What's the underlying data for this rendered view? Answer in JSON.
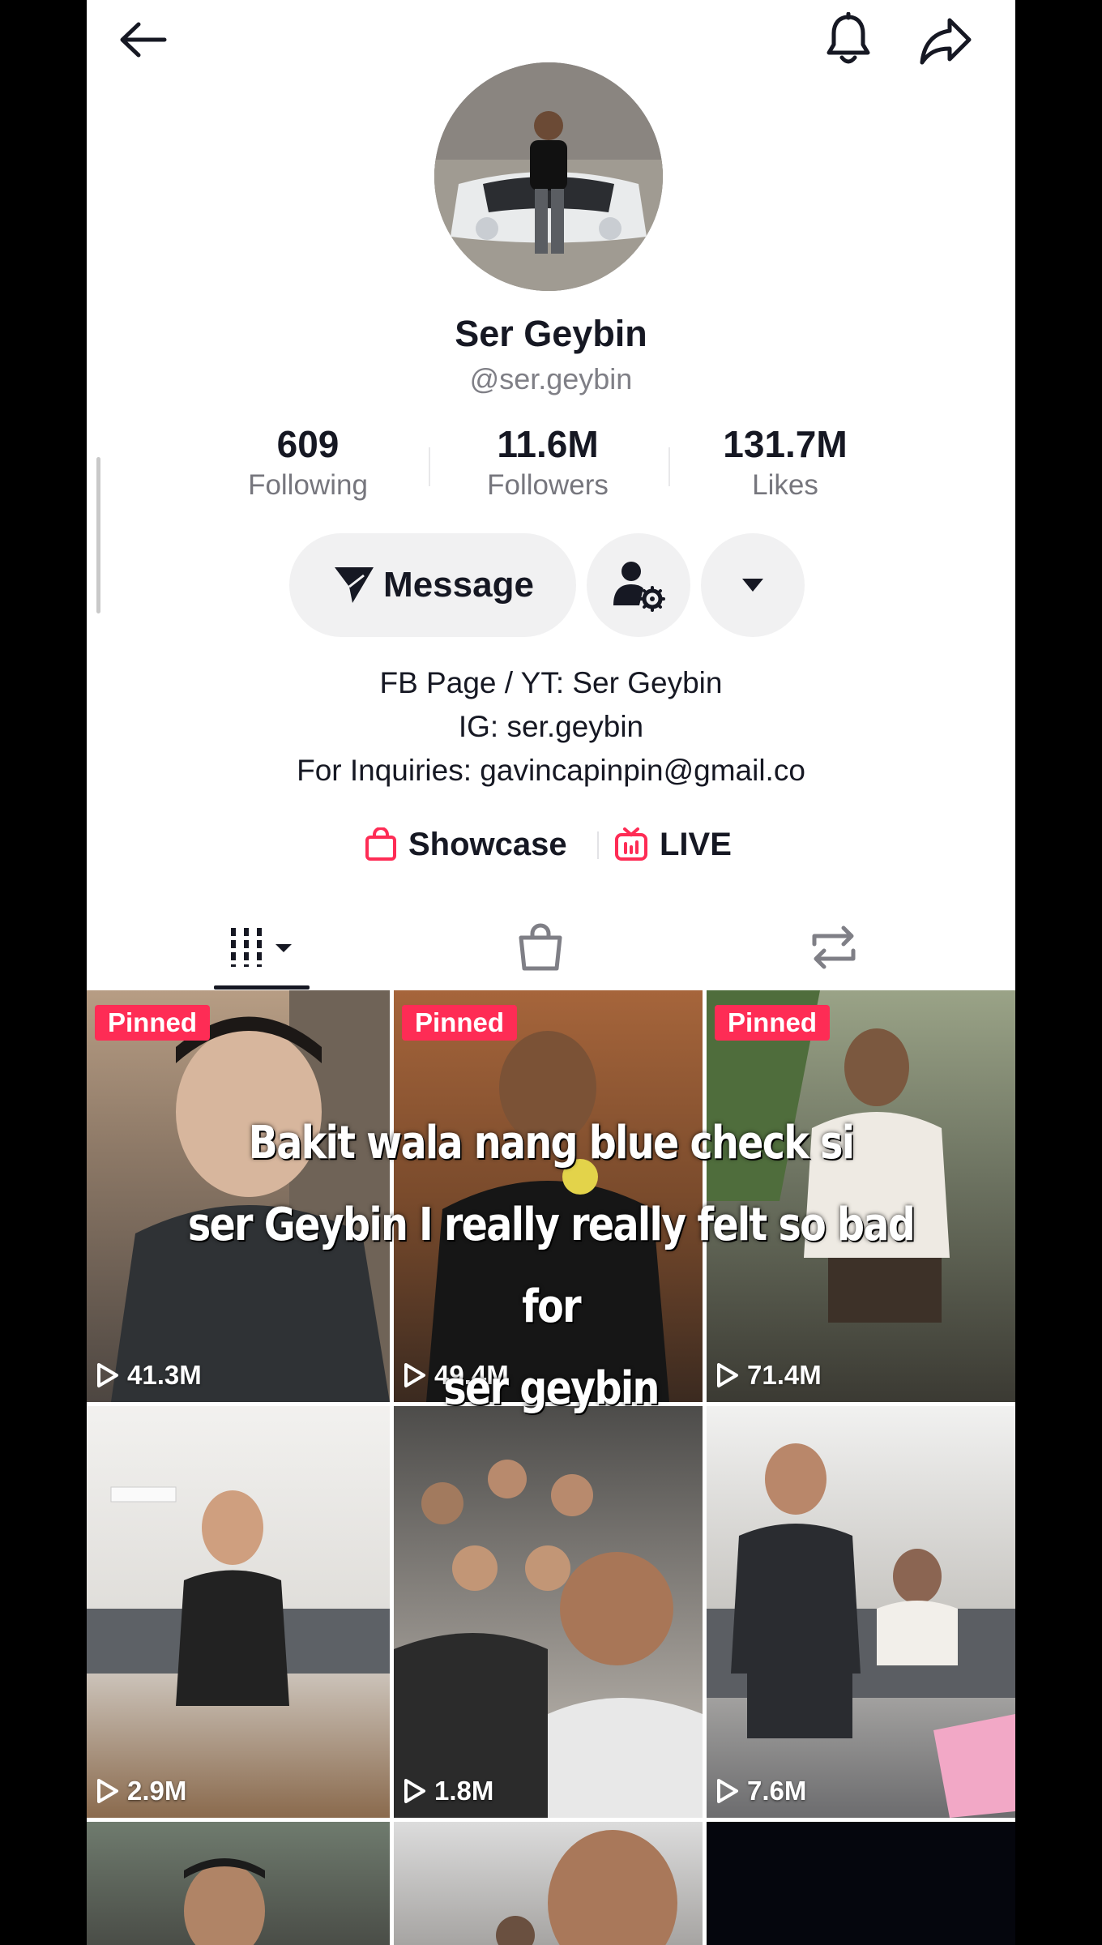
{
  "profile": {
    "display_name": "Ser Geybin",
    "username": "@ser.geybin"
  },
  "stats": [
    {
      "value": "609",
      "label": "Following"
    },
    {
      "value": "11.6M",
      "label": "Followers"
    },
    {
      "value": "131.7M",
      "label": "Likes"
    }
  ],
  "actions": {
    "message_label": "Message"
  },
  "bio": {
    "line1": "FB Page / YT: Ser Geybin",
    "line2": "IG: ser.geybin",
    "line3": "For Inquiries: gavincapinpin@gmail.co"
  },
  "links": {
    "showcase": "Showcase",
    "live": "LIVE"
  },
  "tiles": [
    {
      "pinned": "Pinned",
      "views": "41.3M"
    },
    {
      "pinned": "Pinned",
      "views": "49.4M"
    },
    {
      "pinned": "Pinned",
      "views": "71.4M"
    },
    {
      "views": "2.9M"
    },
    {
      "views": "1.8M"
    },
    {
      "views": "7.6M"
    }
  ],
  "caption": {
    "line1": "Bakit wala nang blue check si",
    "line2": "ser Geybin I really really felt so bad for",
    "line3": "ser geybin"
  },
  "icons": {
    "back": "back-arrow-icon",
    "bell": "bell-icon",
    "share": "share-icon",
    "message": "send-icon",
    "add_friend": "person-gear-icon",
    "more": "dropdown-triangle-icon",
    "showcase": "shopping-bag-icon",
    "live": "live-tv-icon",
    "videos_tab": "grid-bars-icon",
    "shop_tab": "shopping-bag-icon",
    "reposts_tab": "repost-icon",
    "play": "play-icon"
  },
  "colors": {
    "accent": "#fe2c55",
    "text": "#161823",
    "secondary_text": "#7f7f86",
    "button_bg": "#f1f1f2"
  }
}
